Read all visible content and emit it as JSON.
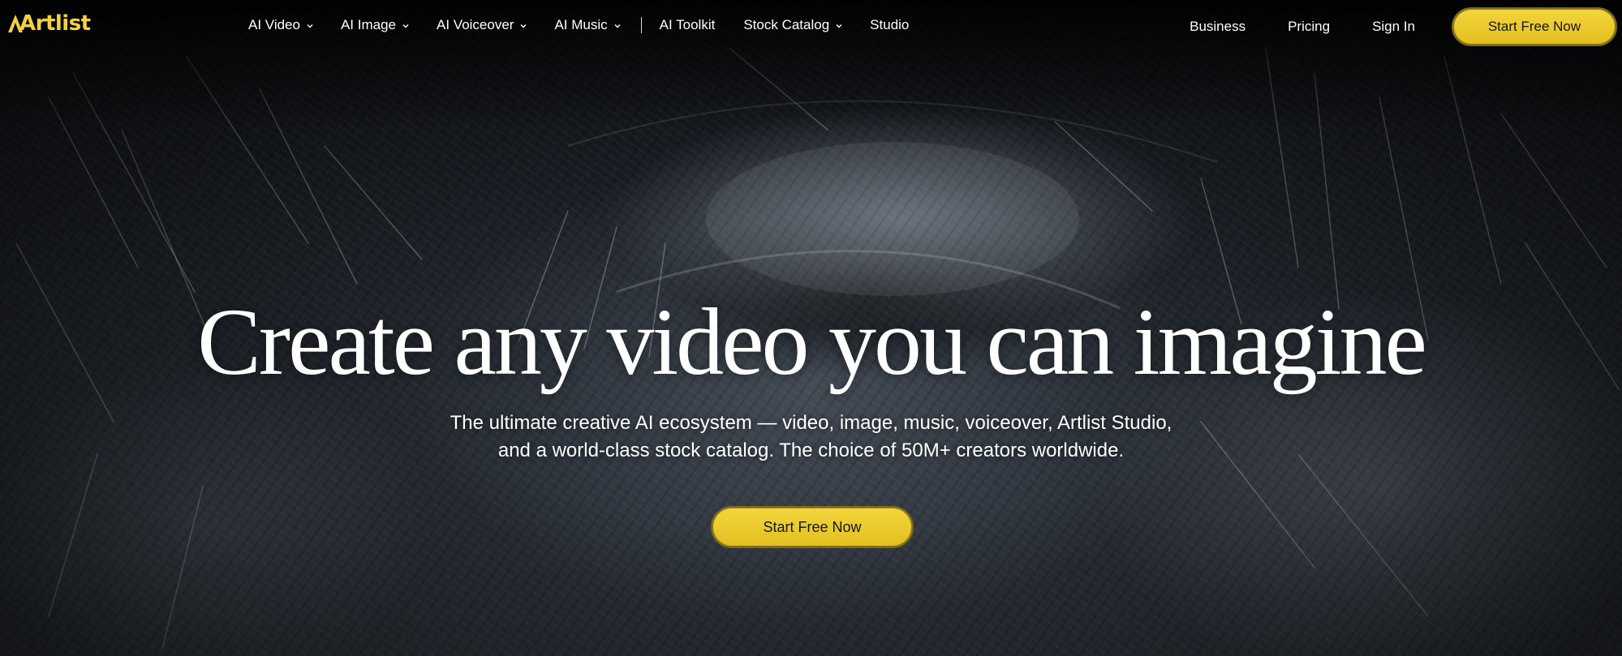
{
  "brand": {
    "name": "Artlist",
    "accent_color": "#f5d13a"
  },
  "nav": {
    "items": [
      {
        "label": "AI Video",
        "has_dropdown": true
      },
      {
        "label": "AI Image",
        "has_dropdown": true
      },
      {
        "label": "AI Voiceover",
        "has_dropdown": true
      },
      {
        "label": "AI Music",
        "has_dropdown": true
      },
      {
        "label": "AI Toolkit",
        "has_dropdown": false
      },
      {
        "label": "Stock Catalog",
        "has_dropdown": true
      },
      {
        "label": "Studio",
        "has_dropdown": false
      }
    ],
    "right_items": [
      {
        "label": "Business"
      },
      {
        "label": "Pricing"
      },
      {
        "label": "Sign In"
      }
    ],
    "cta_label": "Start Free Now"
  },
  "hero": {
    "headline": "Create any video you can imagine",
    "subtext_line1": "The ultimate creative AI ecosystem — video, image, music, voiceover, Artlist Studio,",
    "subtext_line2": "and a world-class stock catalog. The choice of 50M+ creators worldwide.",
    "cta_label": "Start Free Now",
    "background": "close-up-elephant-eye-image"
  }
}
